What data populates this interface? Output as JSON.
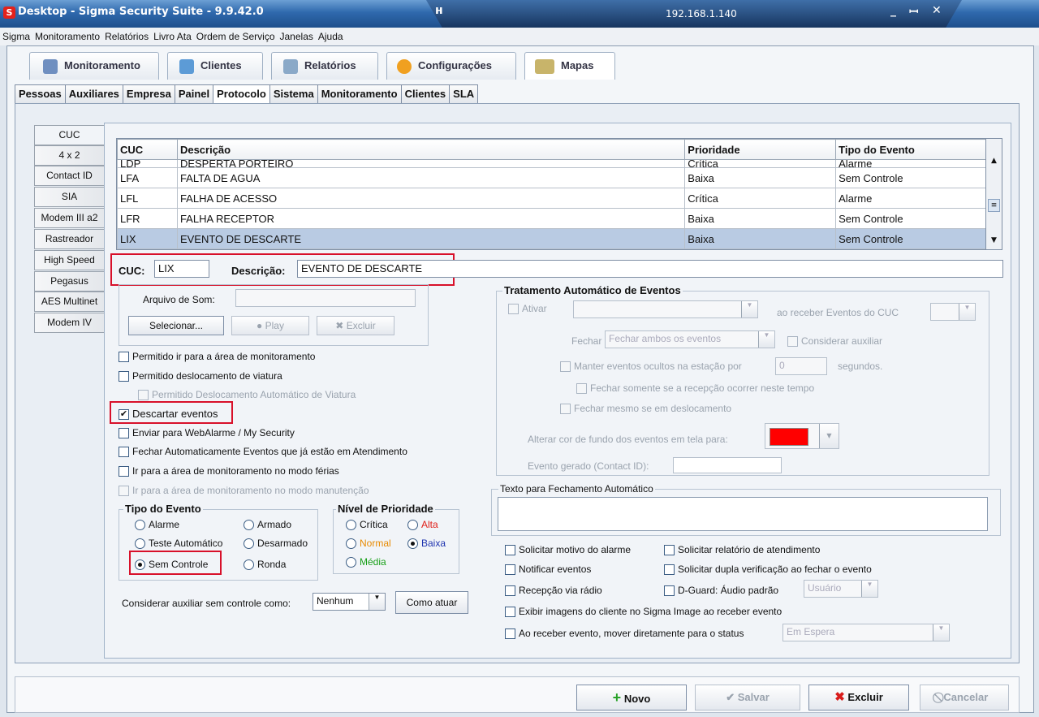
{
  "window": {
    "title": "Desktop - Sigma Security Suite - 9.9.42.0",
    "ip": "192.168.1.140",
    "logo": "S",
    "pin": "ʜ",
    "minimize": "_",
    "maximize": "ꟷ",
    "restore": "ꟷ",
    "close": "✕"
  },
  "menu": [
    "Sigma",
    "Monitoramento",
    "Relatórios",
    "Livro Ata",
    "Ordem de Serviço",
    "Janelas",
    "Ajuda"
  ],
  "module_tabs": [
    "Monitoramento",
    "Clientes",
    "Relatórios",
    "Configurações",
    "Mapas"
  ],
  "sub_tabs": [
    "Pessoas",
    "Auxiliares",
    "Empresa",
    "Painel",
    "Protocolo",
    "Sistema",
    "Monitoramento",
    "Clientes",
    "SLA"
  ],
  "protocol_tabs": [
    "CUC",
    "4 x 2",
    "Contact ID",
    "SIA",
    "Modem III a2",
    "Rastreador",
    "High Speed",
    "Pegasus",
    "AES Multinet",
    "Modem IV"
  ],
  "table": {
    "headers": [
      "CUC",
      "Descrição",
      "Prioridade",
      "Tipo do Evento"
    ],
    "partial_row": [
      "LDP",
      "DESPERTA PORTEIRO",
      "Crítica",
      "Alarme"
    ],
    "rows": [
      [
        "LFA",
        "FALTA DE AGUA",
        "Baixa",
        "Sem Controle"
      ],
      [
        "LFL",
        "FALHA DE ACESSO",
        "Crítica",
        "Alarme"
      ],
      [
        "LFR",
        "FALHA RECEPTOR",
        "Baixa",
        "Sem Controle"
      ],
      [
        "LIX",
        "EVENTO DE DESCARTE",
        "Baixa",
        "Sem Controle"
      ]
    ]
  },
  "form": {
    "cuc_label": "CUC:",
    "cuc_value": "LIX",
    "descricao_label": "Descrição:",
    "descricao_value": "EVENTO DE DESCARTE",
    "arquivo_som_label": "Arquivo de Som:",
    "selecionar": "Selecionar...",
    "play": "Play",
    "excluir": "Excluir",
    "checks": {
      "permitido_ir": "Permitido ir para a área de monitoramento",
      "permitido_desloc": "Permitido deslocamento de viatura",
      "permitido_desloc_auto": "Permitido Deslocamento Automático de Viatura",
      "descartar": "Descartar eventos",
      "enviar_webalarme": "Enviar para WebAlarme / My Security",
      "fechar_auto": "Fechar Automaticamente Eventos que já estão em Atendimento",
      "modo_ferias": "Ir para a área de monitoramento no modo férias",
      "modo_manutencao": "Ir para a área de monitoramento no modo manutenção"
    },
    "tipo_evento": {
      "title": "Tipo do Evento",
      "alarme": "Alarme",
      "armado": "Armado",
      "teste": "Teste Automático",
      "desarmado": "Desarmado",
      "sem_controle": "Sem Controle",
      "ronda": "Ronda"
    },
    "prioridade": {
      "title": "Nível de Prioridade",
      "critica": "Crítica",
      "alta": "Alta",
      "normal": "Normal",
      "baixa": "Baixa",
      "media": "Média"
    },
    "considerar_label": "Considerar auxiliar sem controle como:",
    "considerar_value": "Nenhum",
    "como_atuar": "Como atuar"
  },
  "tratamento": {
    "title": "Tratamento Automático de Eventos",
    "ativar": "Ativar",
    "ao_receber": "ao receber Eventos do CUC",
    "fechar": "Fechar",
    "fechar_value": "Fechar ambos os eventos",
    "considerar_aux": "Considerar auxiliar",
    "manter": "Manter eventos ocultos na estação por",
    "manter_value": "0",
    "segundos": "segundos.",
    "fechar_somente": "Fechar somente se a recepção ocorrer neste tempo",
    "fechar_mesmo": "Fechar mesmo se em deslocamento",
    "alterar_cor": "Alterar cor de fundo dos eventos em tela para:",
    "evento_gerado": "Evento gerado (Contact ID):"
  },
  "texto_fechamento": {
    "title": "Texto para Fechamento Automático"
  },
  "opcoes": {
    "solicitar_motivo": "Solicitar motivo do alarme",
    "solicitar_relatorio": "Solicitar relatório de atendimento",
    "notificar": "Notificar eventos",
    "dupla_verificacao": "Solicitar dupla verificação ao fechar o evento",
    "recepcao_radio": "Recepção via rádio",
    "dguard": "D-Guard: Áudio padrão",
    "dguard_value": "Usuário",
    "exibir_imagens": "Exibir imagens do cliente no Sigma Image ao receber evento",
    "mover_status": "Ao receber evento, mover diretamente para o status",
    "mover_status_value": "Em Espera"
  },
  "actions": {
    "novo": "Novo",
    "salvar": "Salvar",
    "excluir": "Excluir",
    "cancelar": "Cancelar"
  },
  "colors": {
    "event_bg_color": "#ff0000",
    "highlight_border": "#d8102a",
    "selected_row": "#b9cbe3"
  },
  "glyphs": {
    "check": "✔",
    "down": "▼",
    "up": "▲",
    "play": "●",
    "plus": "+",
    "x": "✖",
    "cancel": "⃠",
    "grip": "≡"
  }
}
